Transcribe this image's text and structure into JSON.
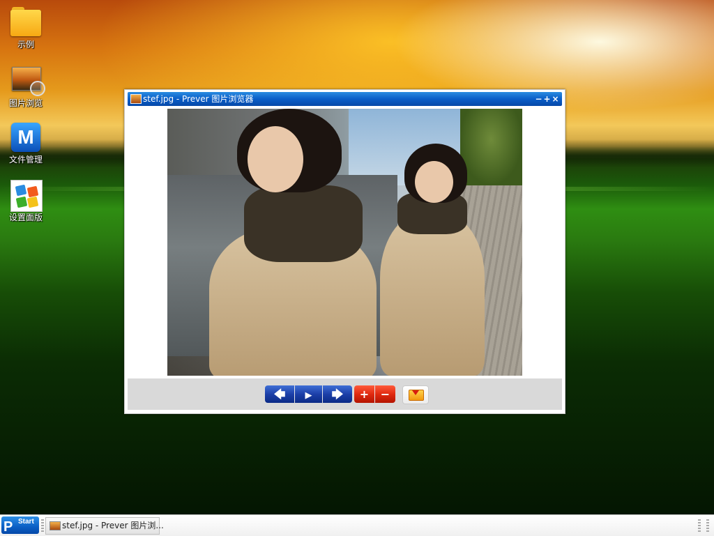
{
  "desktop": {
    "icons": [
      {
        "label": "示例",
        "icon": "folder-icon"
      },
      {
        "label": "图片浏览",
        "icon": "image-viewer-icon"
      },
      {
        "label": "文件管理",
        "icon": "file-manager-icon"
      },
      {
        "label": "设置面版",
        "icon": "control-panel-icon"
      }
    ]
  },
  "window": {
    "title": "stef.jpg - Prever 图片浏览器",
    "controls": {
      "minimize": "−",
      "maximize": "+",
      "close": "×"
    },
    "toolbar": {
      "prev_icon": "arrow-left-icon",
      "play_icon": "play-icon",
      "next_icon": "arrow-right-icon",
      "zoom_in_icon": "plus-icon",
      "zoom_out_icon": "minus-icon",
      "save_icon": "download-folder-icon",
      "prev_glyph": "🡄",
      "play_glyph": "▶",
      "next_glyph": "🡆",
      "zoom_in_glyph": "+",
      "zoom_out_glyph": "−"
    }
  },
  "taskbar": {
    "start_letter": "P",
    "start_label": "Start",
    "task_label": "stef.jpg - Prever 图片浏..."
  },
  "colors": {
    "titlebar": "#0a5ec8",
    "nav_blue": "#1c3fa8",
    "zoom_red": "#e02a10"
  }
}
